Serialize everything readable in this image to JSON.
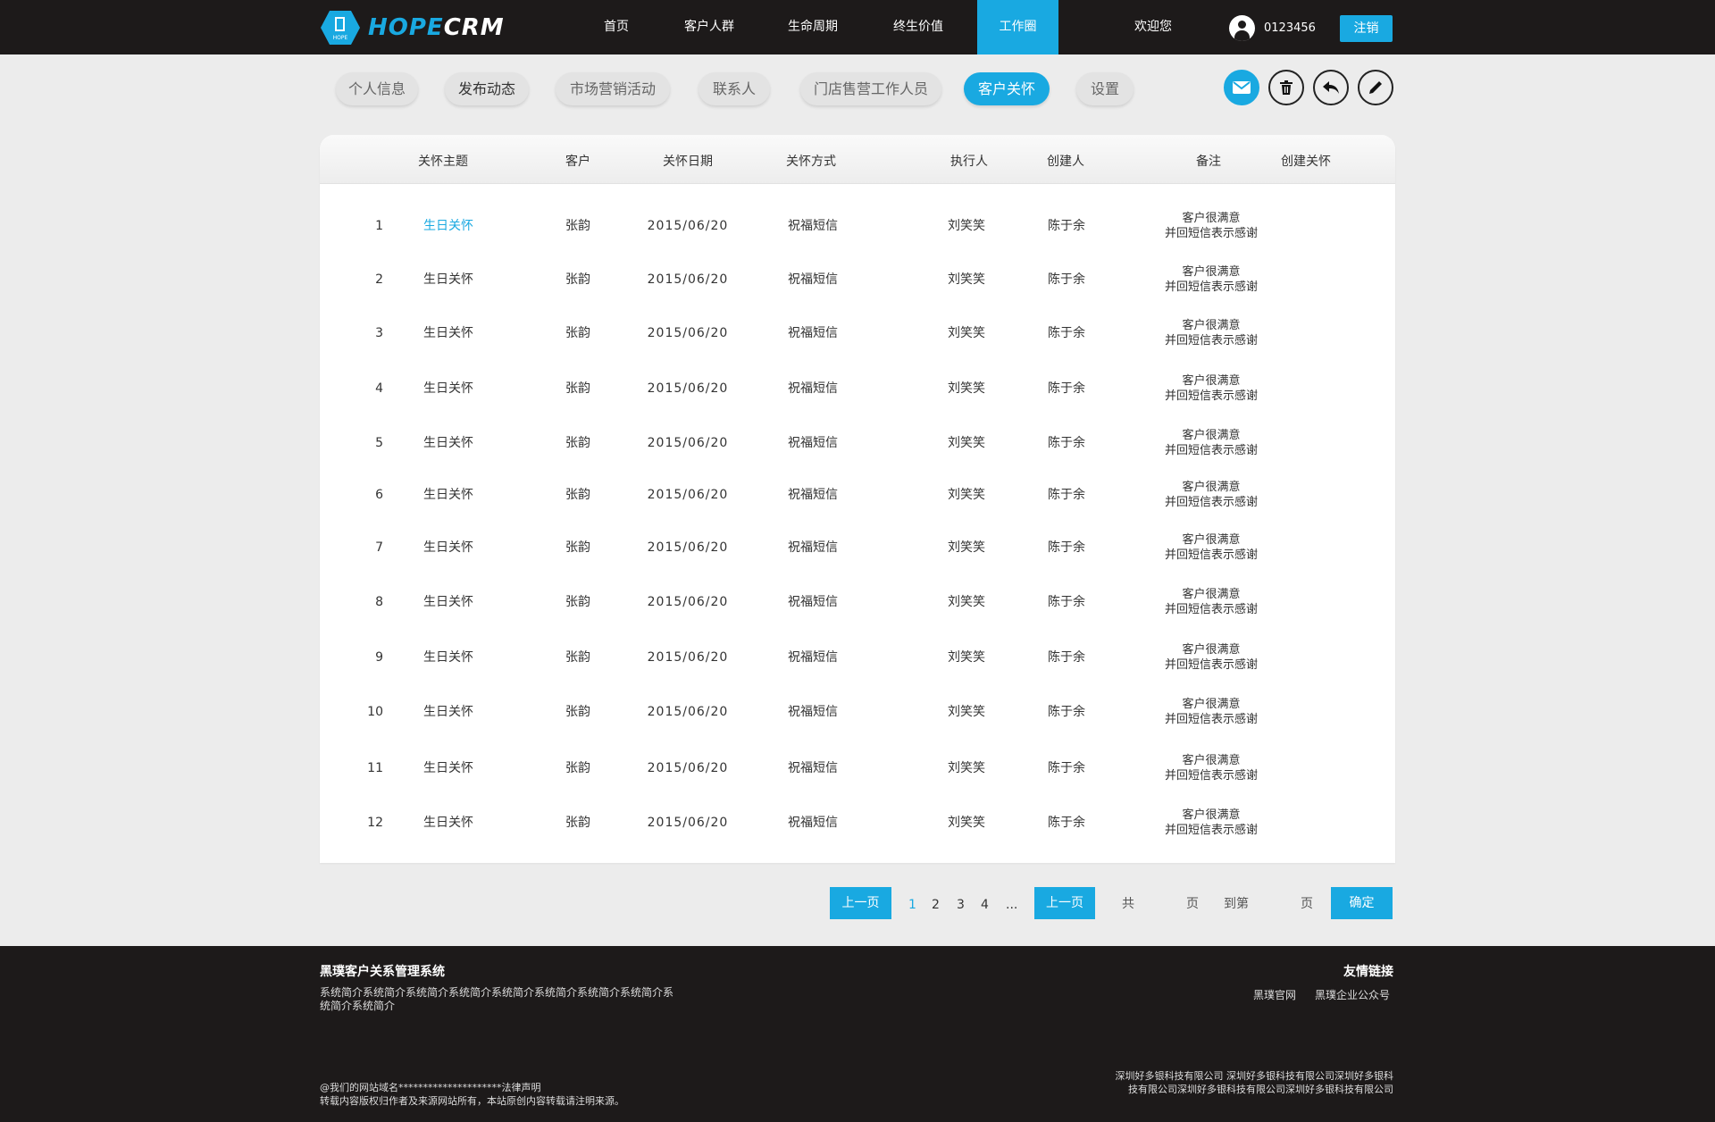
{
  "header": {
    "logo_hope": "HOPE",
    "logo_crm": "CRM",
    "logo_badge": "HOPE",
    "nav": [
      "首页",
      "客户人群",
      "生命周期",
      "终生价值",
      "工作圈"
    ],
    "welcome": "欢迎您",
    "user_id": "0123456",
    "logout": "注销"
  },
  "subtabs": [
    "个人信息",
    "发布动态",
    "市场营销活动",
    "联系人",
    "门店售营工作人员",
    "客户关怀",
    "设置"
  ],
  "actions": [
    "mail-icon",
    "trash-icon",
    "reply-icon",
    "edit-icon"
  ],
  "table": {
    "headers": [
      "关怀主题",
      "客户",
      "关怀日期",
      "关怀方式",
      "执行人",
      "创建人",
      "备注",
      "创建关怀"
    ],
    "rows": [
      {
        "no": "1",
        "topic": "生日关怀",
        "customer": "张韵",
        "date": "2015/06/20",
        "method": "祝福短信",
        "executor": "刘笑笑",
        "creator": "陈于余",
        "note1": "客户很满意",
        "note2": "并回短信表示感谢"
      },
      {
        "no": "2",
        "topic": "生日关怀",
        "customer": "张韵",
        "date": "2015/06/20",
        "method": "祝福短信",
        "executor": "刘笑笑",
        "creator": "陈于余",
        "note1": "客户很满意",
        "note2": "并回短信表示感谢"
      },
      {
        "no": "3",
        "topic": "生日关怀",
        "customer": "张韵",
        "date": "2015/06/20",
        "method": "祝福短信",
        "executor": "刘笑笑",
        "creator": "陈于余",
        "note1": "客户很满意",
        "note2": "并回短信表示感谢"
      },
      {
        "no": "4",
        "topic": "生日关怀",
        "customer": "张韵",
        "date": "2015/06/20",
        "method": "祝福短信",
        "executor": "刘笑笑",
        "creator": "陈于余",
        "note1": "客户很满意",
        "note2": "并回短信表示感谢"
      },
      {
        "no": "5",
        "topic": "生日关怀",
        "customer": "张韵",
        "date": "2015/06/20",
        "method": "祝福短信",
        "executor": "刘笑笑",
        "creator": "陈于余",
        "note1": "客户很满意",
        "note2": "并回短信表示感谢"
      },
      {
        "no": "6",
        "topic": "生日关怀",
        "customer": "张韵",
        "date": "2015/06/20",
        "method": "祝福短信",
        "executor": "刘笑笑",
        "creator": "陈于余",
        "note1": "客户很满意",
        "note2": "并回短信表示感谢"
      },
      {
        "no": "7",
        "topic": "生日关怀",
        "customer": "张韵",
        "date": "2015/06/20",
        "method": "祝福短信",
        "executor": "刘笑笑",
        "creator": "陈于余",
        "note1": "客户很满意",
        "note2": "并回短信表示感谢"
      },
      {
        "no": "8",
        "topic": "生日关怀",
        "customer": "张韵",
        "date": "2015/06/20",
        "method": "祝福短信",
        "executor": "刘笑笑",
        "creator": "陈于余",
        "note1": "客户很满意",
        "note2": "并回短信表示感谢"
      },
      {
        "no": "9",
        "topic": "生日关怀",
        "customer": "张韵",
        "date": "2015/06/20",
        "method": "祝福短信",
        "executor": "刘笑笑",
        "creator": "陈于余",
        "note1": "客户很满意",
        "note2": "并回短信表示感谢"
      },
      {
        "no": "10",
        "topic": "生日关怀",
        "customer": "张韵",
        "date": "2015/06/20",
        "method": "祝福短信",
        "executor": "刘笑笑",
        "creator": "陈于余",
        "note1": "客户很满意",
        "note2": "并回短信表示感谢"
      },
      {
        "no": "11",
        "topic": "生日关怀",
        "customer": "张韵",
        "date": "2015/06/20",
        "method": "祝福短信",
        "executor": "刘笑笑",
        "creator": "陈于余",
        "note1": "客户很满意",
        "note2": "并回短信表示感谢"
      },
      {
        "no": "12",
        "topic": "生日关怀",
        "customer": "张韵",
        "date": "2015/06/20",
        "method": "祝福短信",
        "executor": "刘笑笑",
        "creator": "陈于余",
        "note1": "客户很满意",
        "note2": "并回短信表示感谢"
      }
    ]
  },
  "pagination": {
    "prev": "上一页",
    "pages": [
      "1",
      "2",
      "3",
      "4"
    ],
    "ellipsis": "...",
    "next": "上一页",
    "total_label": "共",
    "page_unit": "页",
    "goto_label": "到第",
    "goto_unit": "页",
    "confirm": "确定"
  },
  "footer": {
    "title": "黑璞客户关系管理系统",
    "desc": "系统简介系统简介系统简介系统简介系统简介系统简介系统简介系统简介系统简介系统简介",
    "legal1": "@我们的网站域名*********************法律声明",
    "legal2": "转载内容版权归作者及来源网站所有，本站原创内容转载请注明来源。",
    "links_title": "友情链接",
    "links": [
      "黑璞官网",
      "黑璞企业公众号"
    ],
    "company": "深圳好多银科技有限公司 深圳好多银科技有限公司深圳好多银科技有限公司深圳好多银科技有限公司深圳好多银科技有限公司"
  },
  "colors": {
    "accent": "#19a9e1",
    "topbar": "#1d1a1a",
    "page_bg": "#ececec"
  }
}
